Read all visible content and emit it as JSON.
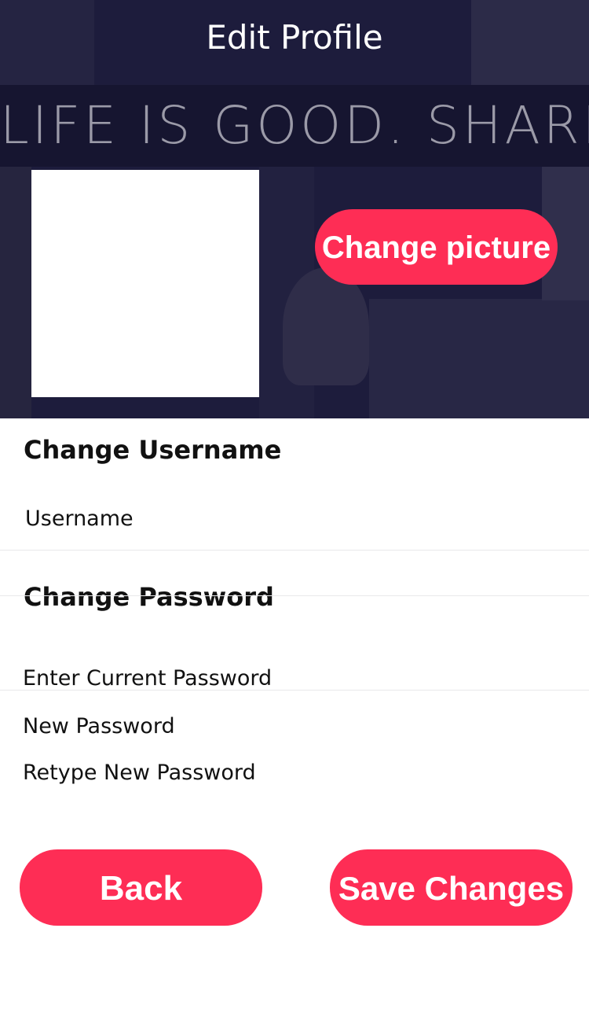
{
  "header": {
    "title": "Edit Profile",
    "banner_tagline": "LIFE IS GOOD. SHARE IT."
  },
  "profile": {
    "change_picture_label": "Change picture"
  },
  "username_section": {
    "heading": "Change Username",
    "username_placeholder": "Username"
  },
  "password_section": {
    "heading": "Change Password",
    "current_placeholder": "Enter Current Password",
    "new_placeholder": "New Password",
    "retype_placeholder": "Retype New Password"
  },
  "actions": {
    "back_label": "Back",
    "save_label": "Save Changes"
  },
  "colors": {
    "accent": "#fe2d55",
    "banner_bg": "#1d1c3c"
  }
}
